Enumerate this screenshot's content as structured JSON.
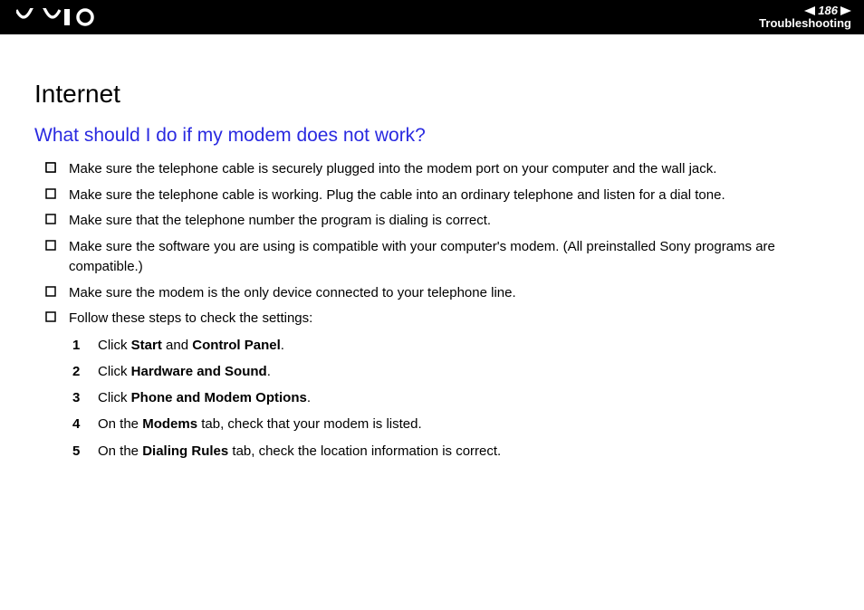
{
  "header": {
    "page_number": "186",
    "section": "Troubleshooting"
  },
  "page": {
    "title": "Internet",
    "question": "What should I do if my modem does not work?",
    "bullets": [
      "Make sure the telephone cable is securely plugged into the modem port on your computer and the wall jack.",
      "Make sure the telephone cable is working. Plug the cable into an ordinary telephone and listen for a dial tone.",
      "Make sure that the telephone number the program is dialing is correct.",
      "Make sure the software you are using is compatible with your computer's modem. (All preinstalled Sony programs are compatible.)",
      "Make sure the modem is the only device connected to your telephone line.",
      "Follow these steps to check the settings:"
    ],
    "steps": [
      {
        "n": "1",
        "pre": "Click ",
        "b1": "Start",
        "mid": " and ",
        "b2": "Control Panel",
        "post": "."
      },
      {
        "n": "2",
        "pre": "Click ",
        "b1": "Hardware and Sound",
        "mid": "",
        "b2": "",
        "post": "."
      },
      {
        "n": "3",
        "pre": "Click ",
        "b1": "Phone and Modem Options",
        "mid": "",
        "b2": "",
        "post": "."
      },
      {
        "n": "4",
        "pre": "On the ",
        "b1": "Modems",
        "mid": " tab, check that your modem is listed.",
        "b2": "",
        "post": ""
      },
      {
        "n": "5",
        "pre": "On the ",
        "b1": "Dialing Rules",
        "mid": " tab, check the location information is correct.",
        "b2": "",
        "post": ""
      }
    ]
  }
}
